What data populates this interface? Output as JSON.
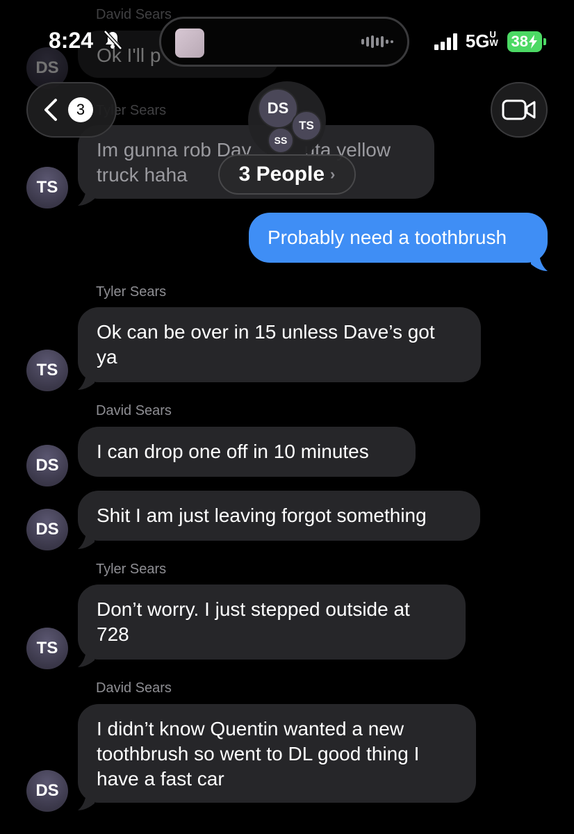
{
  "status_bar": {
    "time": "8:24",
    "network": "5G",
    "network_sup": "UW",
    "battery": "38"
  },
  "nav": {
    "back_badge": "3",
    "people_label": "3 People",
    "group_initials": [
      "DS",
      "TS",
      "SS"
    ]
  },
  "messages": [
    {
      "sender": "David Sears",
      "initials": "DS",
      "text": "Ok I'll p",
      "obscured": true
    },
    {
      "sender": "Tyler Sears",
      "initials": "TS",
      "lines": [
        "Im gunna rob Dav",
        "uta yellow",
        "truck haha"
      ],
      "obscured": true
    },
    {
      "sender": "",
      "outgoing": true,
      "text": "Probably need a toothbrush"
    },
    {
      "sender": "Tyler Sears",
      "initials": "TS",
      "lines": [
        "Ok can be over in 15 unless Dave’s got",
        "ya"
      ]
    },
    {
      "sender": "David Sears",
      "initials": "DS",
      "text": "I can drop one off in 10 minutes"
    },
    {
      "sender": "",
      "initials": "DS",
      "text": "Shit I am just leaving forgot something"
    },
    {
      "sender": "Tyler Sears",
      "initials": "TS",
      "lines": [
        "Don’t worry. I just stepped outside at",
        "728"
      ]
    },
    {
      "sender": "David Sears",
      "initials": "DS",
      "lines": [
        "I didn’t know Quentin wanted a new",
        "toothbrush so went to DL good thing I",
        "have a fast car"
      ]
    }
  ],
  "colors": {
    "background": "#000000",
    "incoming_bubble": "#262629",
    "outgoing_bubble": "#3f8ef5",
    "sender_name": "#8e8e93",
    "battery": "#4cd964"
  },
  "icons": [
    "back-chevron-icon",
    "silent-bell-icon",
    "audio-wave-icon",
    "cellular-signal-icon",
    "video-camera-icon",
    "chevron-right-icon"
  ]
}
